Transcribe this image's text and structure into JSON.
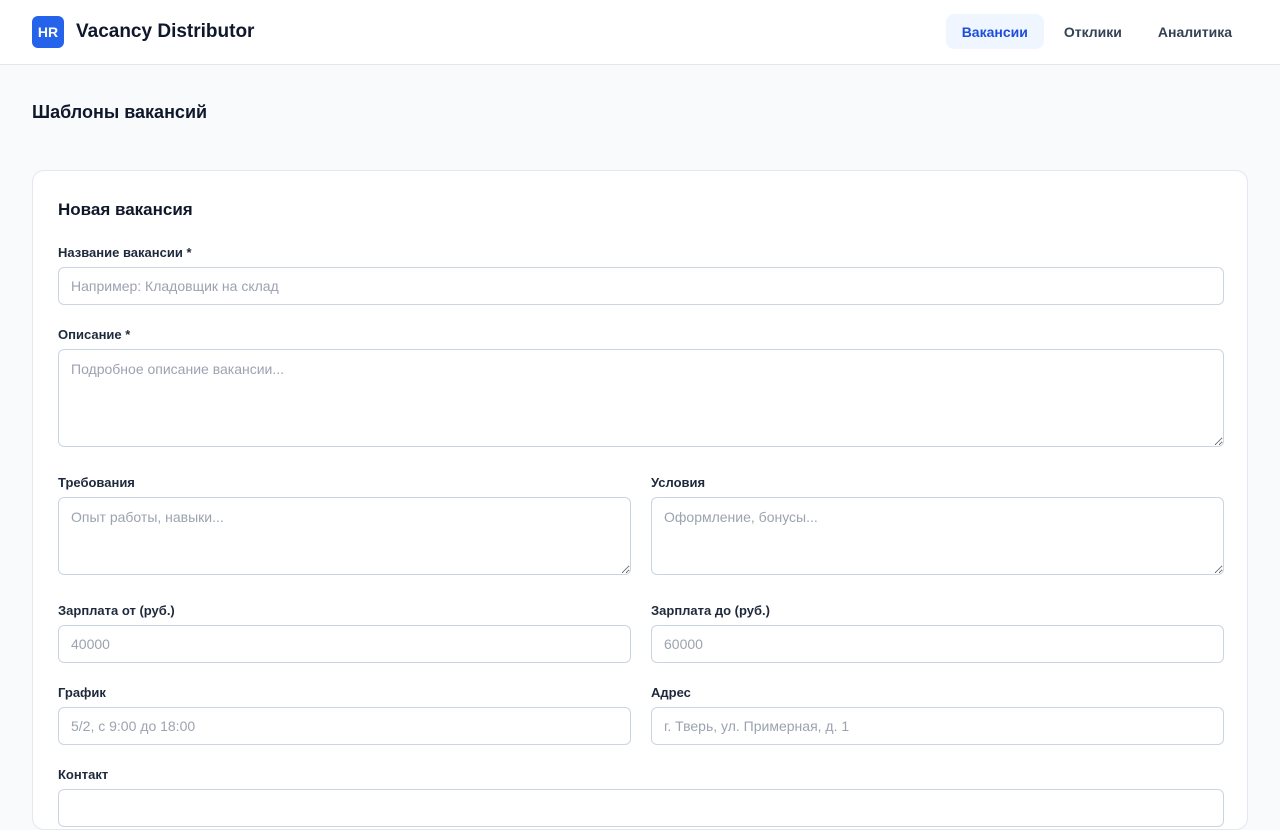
{
  "app": {
    "logo_text": "HR",
    "title": "Vacancy Distributor"
  },
  "nav": {
    "items": [
      {
        "label": "Вакансии",
        "active": true
      },
      {
        "label": "Отклики",
        "active": false
      },
      {
        "label": "Аналитика",
        "active": false
      }
    ]
  },
  "page": {
    "title": "Шаблоны вакансий"
  },
  "form": {
    "title": "Новая вакансия",
    "fields": {
      "name": {
        "label": "Название вакансии *",
        "value": "",
        "placeholder": "Например: Кладовщик на склад"
      },
      "description": {
        "label": "Описание *",
        "value": "",
        "placeholder": "Подробное описание вакансии..."
      },
      "requirements": {
        "label": "Требования",
        "value": "",
        "placeholder": "Опыт работы, навыки..."
      },
      "conditions": {
        "label": "Условия",
        "value": "",
        "placeholder": "Оформление, бонусы..."
      },
      "salary_from": {
        "label": "Зарплата от (руб.)",
        "value": "",
        "placeholder": "40000"
      },
      "salary_to": {
        "label": "Зарплата до (руб.)",
        "value": "",
        "placeholder": "60000"
      },
      "schedule": {
        "label": "График",
        "value": "",
        "placeholder": "5/2, с 9:00 до 18:00"
      },
      "address": {
        "label": "Адрес",
        "value": "",
        "placeholder": "г. Тверь, ул. Примерная, д. 1"
      },
      "contact": {
        "label": "Контакт",
        "value": "",
        "placeholder": ""
      }
    }
  }
}
